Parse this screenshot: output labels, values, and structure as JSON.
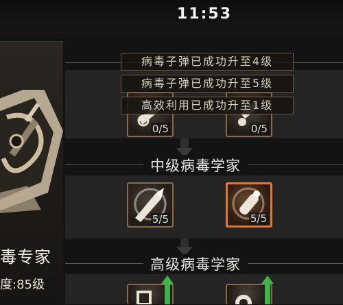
{
  "status": {
    "time": "11:53"
  },
  "profile": {
    "title": "毒专家",
    "level": "度:85级"
  },
  "notifications": [
    "病毒子弹已成功升至4级",
    "病毒子弹已成功升至5级",
    "高效利用已成功升至1级"
  ],
  "tiers": [
    {
      "name": "",
      "skills": [
        {
          "icon": "virus-syringe-icon",
          "count": "0/5"
        },
        {
          "icon": "virus-flask-icon",
          "count": "0/5"
        }
      ]
    },
    {
      "name": "中级病毒学家",
      "skills": [
        {
          "icon": "virus-bullet-icon",
          "count": "5/5"
        },
        {
          "icon": "efficient-use-icon",
          "count": "5/5"
        }
      ]
    },
    {
      "name": "高级病毒学家",
      "skills": [
        {
          "icon": "advanced-skill-icon",
          "count": ""
        },
        {
          "icon": "advanced-skill-icon",
          "count": ""
        }
      ]
    }
  ],
  "colors": {
    "accent": "#e07a2a",
    "upgrade": "#3fb34a"
  }
}
